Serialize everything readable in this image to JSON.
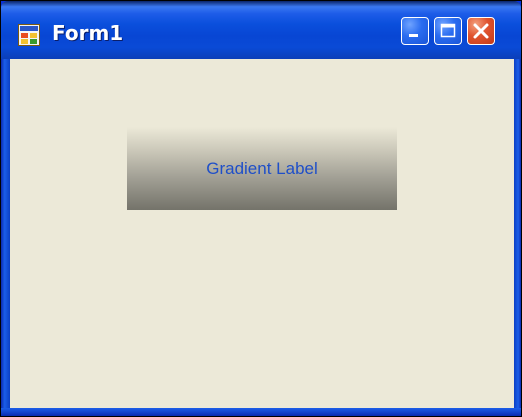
{
  "window": {
    "title": "Form1",
    "icon": "form-app-icon",
    "controls": {
      "minimize": "minimize-icon",
      "maximize": "maximize-icon",
      "close": "close-icon"
    }
  },
  "content": {
    "gradient_label": {
      "text": "Gradient Label",
      "text_color": "#1f4fc8"
    }
  },
  "colors": {
    "client_background": "#ece9d8",
    "titlebar_blue": "#0a4fdc",
    "close_red": "#e0532e"
  }
}
